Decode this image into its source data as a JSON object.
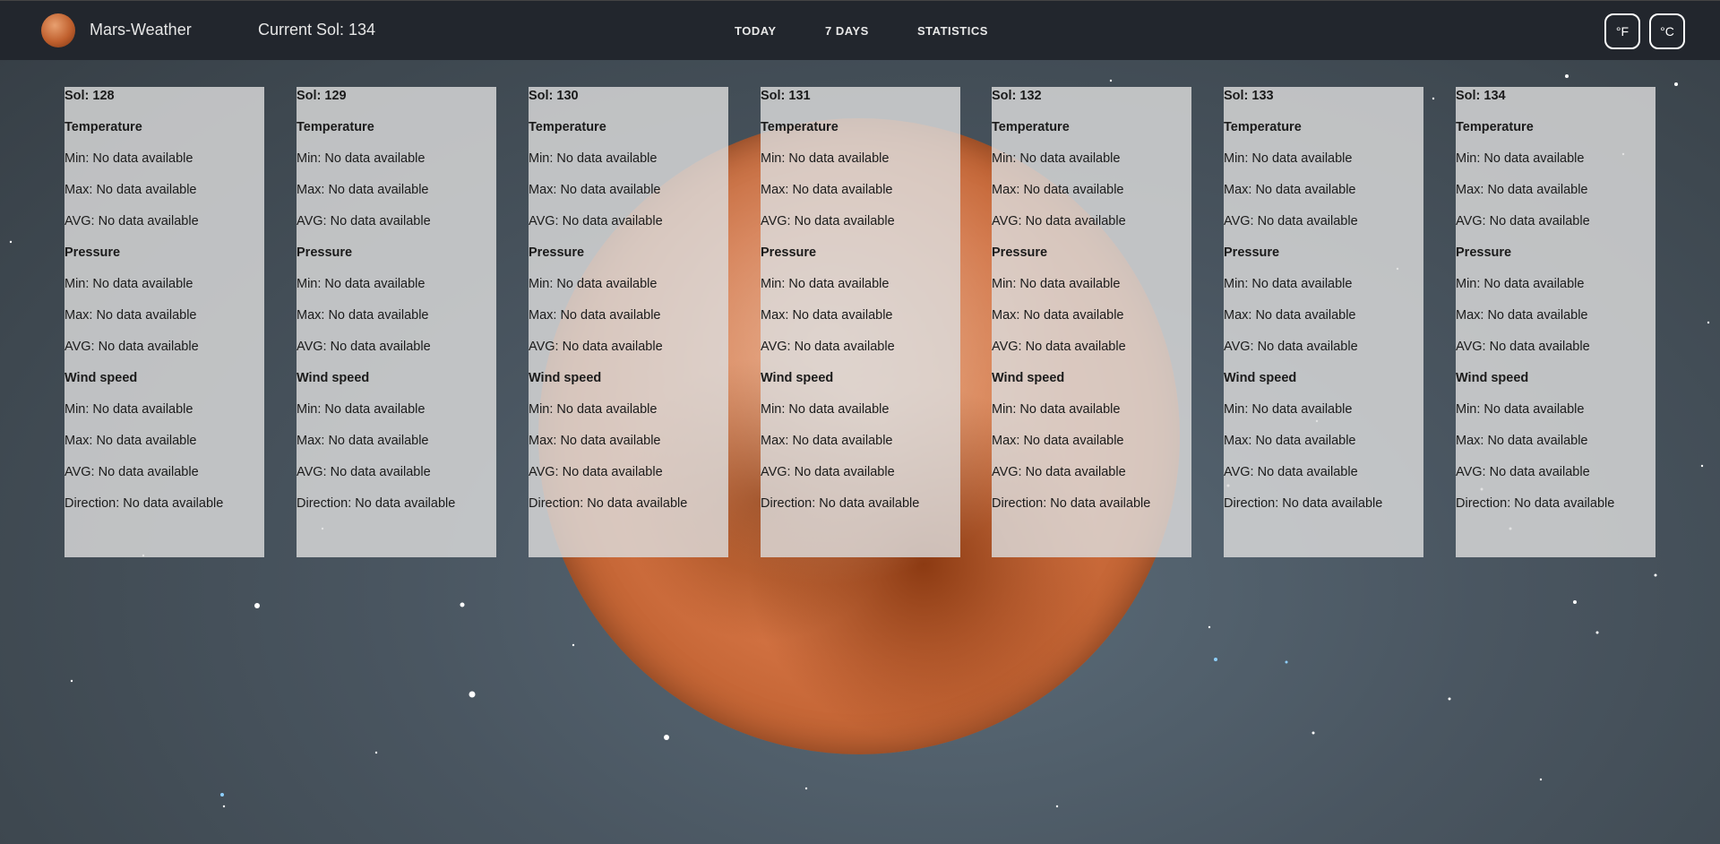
{
  "header": {
    "brand": "Mars-Weather",
    "current_sol": "Current Sol: 134",
    "nav": [
      "TODAY",
      "7 DAYS",
      "STATISTICS"
    ],
    "units": [
      "°F",
      "°C"
    ]
  },
  "labels": {
    "temperature": "Temperature",
    "pressure": "Pressure",
    "wind_speed": "Wind speed",
    "min": "Min: No data available",
    "max": "Max: No data available",
    "avg": "AVG: No data available",
    "direction": "Direction: No data available"
  },
  "sols": [
    "Sol: 128",
    "Sol: 129",
    "Sol: 130",
    "Sol: 131",
    "Sol: 132",
    "Sol: 133",
    "Sol: 134"
  ]
}
